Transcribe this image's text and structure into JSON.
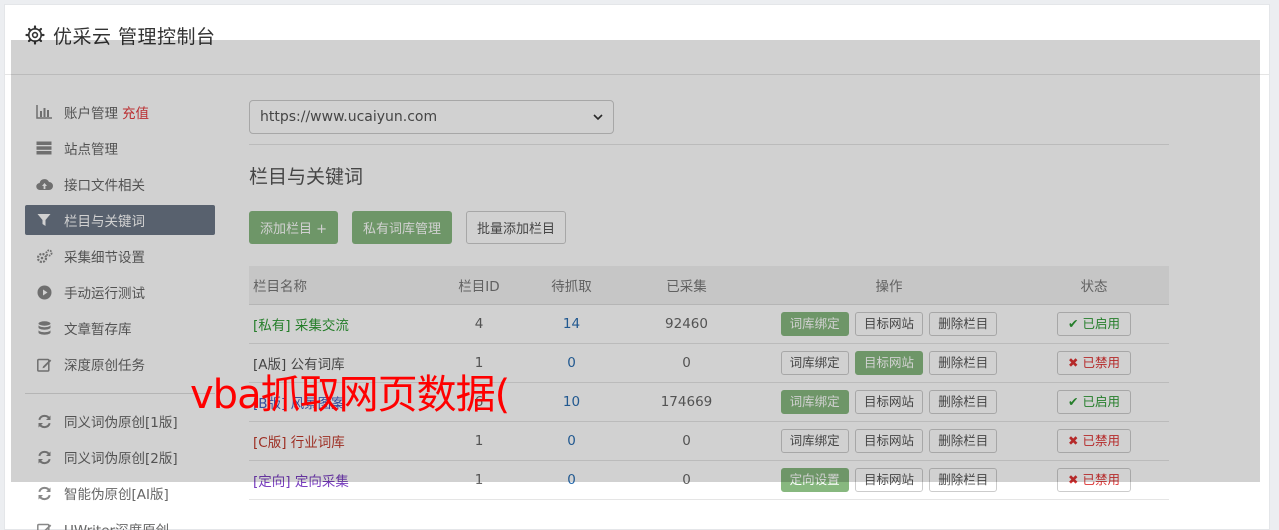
{
  "header": {
    "title": "优采云 管理控制台"
  },
  "sidebar": {
    "items": [
      {
        "label": "账户管理",
        "badge": "充值",
        "icon": "bar-chart-icon"
      },
      {
        "label": "站点管理",
        "icon": "server-icon"
      },
      {
        "label": "接口文件相关",
        "icon": "cloud-upload-icon"
      },
      {
        "label": "栏目与关键词",
        "icon": "filter-icon",
        "active": true
      },
      {
        "label": "采集细节设置",
        "icon": "cogs-icon"
      },
      {
        "label": "手动运行测试",
        "icon": "play-circle-icon"
      },
      {
        "label": "文章暂存库",
        "icon": "database-icon"
      },
      {
        "label": "深度原创任务",
        "icon": "edit-icon"
      }
    ],
    "items2": [
      {
        "label": "同义词伪原创[1版]",
        "icon": "refresh-icon"
      },
      {
        "label": "同义词伪原创[2版]",
        "icon": "refresh-icon"
      },
      {
        "label": "智能伪原创[AI版]",
        "icon": "refresh-icon"
      },
      {
        "label": "UWriter深度原创",
        "icon": "edit-icon"
      }
    ]
  },
  "site_select": {
    "value": "https://www.ucaiyun.com"
  },
  "section": {
    "title": "栏目与关键词"
  },
  "buttons": {
    "add": "添加栏目 +",
    "private": "私有词库管理",
    "batch": "批量添加栏目"
  },
  "table": {
    "headers": [
      "栏目名称",
      "栏目ID",
      "待抓取",
      "已采集",
      "操作",
      "状态"
    ],
    "rows": [
      {
        "tag": "[私有]",
        "name": "采集交流",
        "id": "4",
        "pending": "14",
        "collected": "92460",
        "op1": "词库绑定",
        "op2": "目标网站",
        "op3": "删除栏目",
        "status": "已启用"
      },
      {
        "tag": "[A版]",
        "name": "公有词库",
        "id": "1",
        "pending": "0",
        "collected": "0",
        "op1": "词库绑定",
        "op2": "目标网站",
        "op3": "删除栏目",
        "status": "已禁用"
      },
      {
        "tag": "[B版]",
        "name": "风景图案",
        "id": "6",
        "pending": "10",
        "collected": "174669",
        "op1": "词库绑定",
        "op2": "目标网站",
        "op3": "删除栏目",
        "status": "已启用"
      },
      {
        "tag": "[C版]",
        "name": "行业词库",
        "id": "1",
        "pending": "0",
        "collected": "0",
        "op1": "词库绑定",
        "op2": "目标网站",
        "op3": "删除栏目",
        "status": "已禁用"
      },
      {
        "tag": "[定向]",
        "name": "定向采集",
        "id": "1",
        "pending": "0",
        "collected": "0",
        "op1": "定向设置",
        "op2": "目标网站",
        "op3": "删除栏目",
        "status": "已禁用"
      }
    ]
  },
  "watermark": "vba抓取网页数据("
}
